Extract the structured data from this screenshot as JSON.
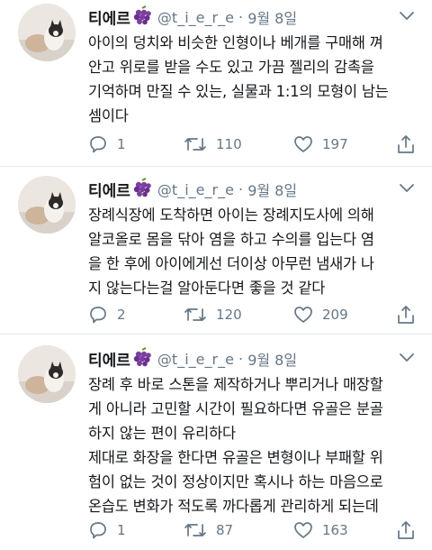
{
  "tweets": [
    {
      "name": "티에르",
      "handle": "@t_i_e_r_e",
      "dot": "·",
      "date": "9월 8일",
      "text": "아이의 덩치와 비슷한 인형이나 베개를 구매해 껴\n안고 위로를 받을 수도 있고 가끔 젤리의 감촉을\n기억하며 만질 수 있는, 실물과 1:1의 모형이 남는\n셈이다",
      "replies": "1",
      "retweets": "110",
      "likes": "197"
    },
    {
      "name": "티에르",
      "handle": "@t_i_e_r_e",
      "dot": "·",
      "date": "9월 8일",
      "text": "장례식장에 도착하면 아이는 장례지도사에 의해\n알코올로 몸을 닦아 염을 하고 수의를 입는다 염\n을 한 후에 아이에게선 더이상 아무런 냄새가 나\n지 않는다는걸 알아둔다면 좋을 것 같다",
      "replies": "2",
      "retweets": "120",
      "likes": "209"
    },
    {
      "name": "티에르",
      "handle": "@t_i_e_r_e",
      "dot": "·",
      "date": "9월 8일",
      "text": "장례 후 바로 스톤을 제작하거나 뿌리거나 매장할\n게 아니라 고민할 시간이 필요하다면 유골은 분골\n하지 않는 편이 유리하다\n제대로 화장을 한다면 유골은 변형이나 부패할 위\n험이 없는 것이 정상이지만 혹시나 하는 마음으로\n온습도 변화가 적도록 까다롭게 관리하게 되는데",
      "replies": "1",
      "retweets": "87",
      "likes": "163"
    }
  ],
  "icons": {
    "emoji": "grapes-emoji-icon",
    "reply": "reply-icon",
    "retweet": "retweet-icon",
    "like": "heart-icon",
    "share": "share-icon",
    "more": "chevron-down-icon"
  },
  "colors": {
    "text": "#14171a",
    "secondary": "#657786",
    "divider": "#e1e8ed",
    "emoji_purple": "#7b3fa0"
  }
}
